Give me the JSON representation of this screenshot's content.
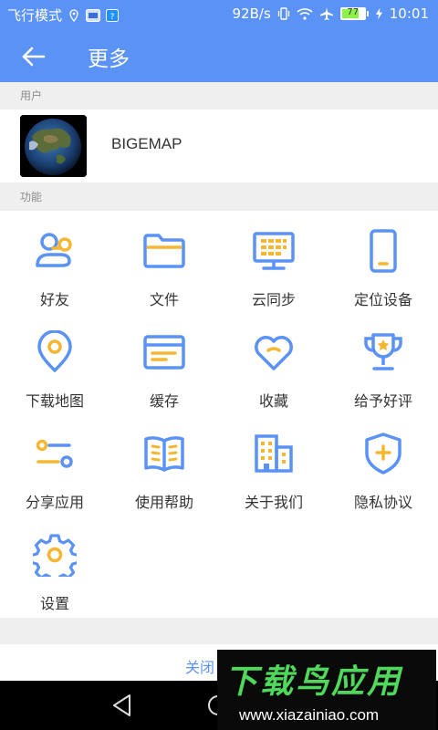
{
  "status_bar": {
    "mode": "飞行模式",
    "speed": "92B/s",
    "battery": "77",
    "battery_level": 0.77,
    "time": "10:01",
    "icons": [
      "location-icon",
      "notification-icon",
      "app-icon",
      "vibrate-icon",
      "wifi-icon",
      "airplane-icon",
      "battery-icon",
      "charging-icon"
    ]
  },
  "app_bar": {
    "title": "更多"
  },
  "sections": {
    "user": "用户",
    "functions": "功能"
  },
  "user": {
    "name": "BIGEMAP"
  },
  "functions": [
    {
      "label": "好友",
      "icon": "friends-icon"
    },
    {
      "label": "文件",
      "icon": "folder-icon"
    },
    {
      "label": "云同步",
      "icon": "cloud-sync-icon"
    },
    {
      "label": "定位设备",
      "icon": "phone-device-icon"
    },
    {
      "label": "下载地图",
      "icon": "map-pin-icon"
    },
    {
      "label": "缓存",
      "icon": "cache-icon"
    },
    {
      "label": "收藏",
      "icon": "heart-icon"
    },
    {
      "label": "给予好评",
      "icon": "trophy-icon"
    },
    {
      "label": "分享应用",
      "icon": "share-sliders-icon"
    },
    {
      "label": "使用帮助",
      "icon": "book-icon"
    },
    {
      "label": "关于我们",
      "icon": "buildings-icon"
    },
    {
      "label": "隐私协议",
      "icon": "shield-icon"
    },
    {
      "label": "设置",
      "icon": "gear-icon"
    }
  ],
  "bottom": {
    "close": "关闭"
  },
  "watermark": {
    "title": "下载鸟应用",
    "url": "www.xiazainiao.com"
  },
  "colors": {
    "primary": "#5b92f5",
    "accent": "#f5b731",
    "watermark_green": "#4fd85c"
  }
}
